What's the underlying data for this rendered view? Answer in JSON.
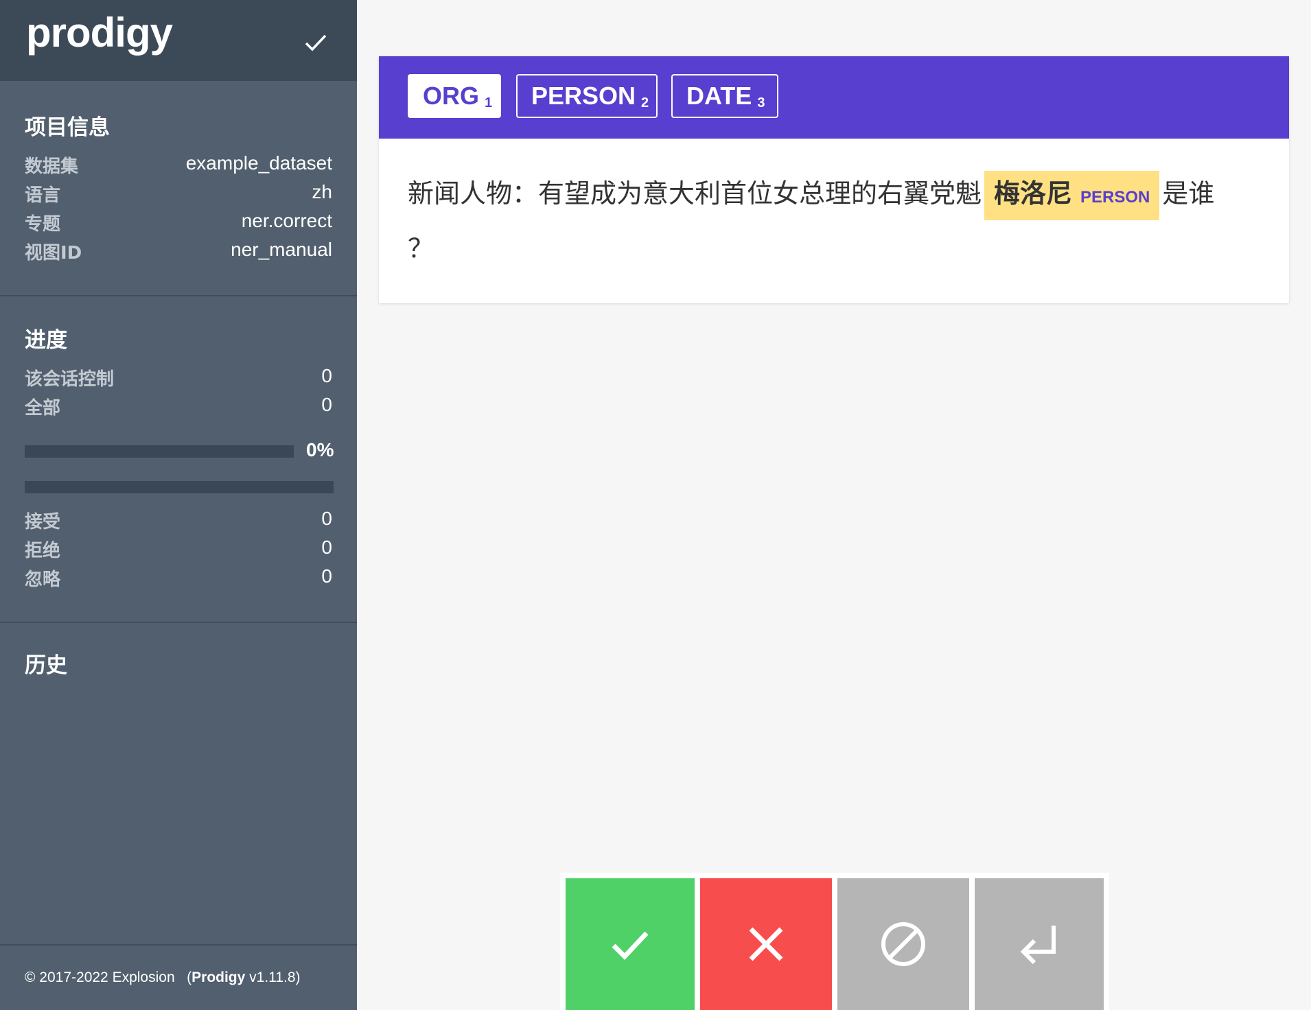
{
  "app": {
    "logo": "prodigy"
  },
  "sidebar": {
    "project_info": {
      "title": "项目信息",
      "rows": [
        {
          "label": "数据集",
          "value": "example_dataset"
        },
        {
          "label": "语言",
          "value": "zh"
        },
        {
          "label": "专题",
          "value": "ner.correct"
        },
        {
          "label": "视图ID",
          "value": "ner_manual"
        }
      ]
    },
    "progress": {
      "title": "进度",
      "rows": [
        {
          "label": "该会话控制",
          "value": "0"
        },
        {
          "label": "全部",
          "value": "0"
        }
      ],
      "percent_label": "0%",
      "percent_value": 0,
      "answers": [
        {
          "label": "接受",
          "value": "0"
        },
        {
          "label": "拒绝",
          "value": "0"
        },
        {
          "label": "忽略",
          "value": "0"
        }
      ]
    },
    "history": {
      "title": "历史"
    },
    "footer": {
      "copyright": "© 2017-2022 Explosion",
      "open": "(",
      "product": "Prodigy",
      "version": "v1.11.8",
      "close": ")"
    }
  },
  "labels": [
    {
      "name": "ORG",
      "key": "1",
      "active": true
    },
    {
      "name": "PERSON",
      "key": "2",
      "active": false
    },
    {
      "name": "DATE",
      "key": "3",
      "active": false
    }
  ],
  "task": {
    "before": "新闻人物：有望成为意大利首位女总理的右翼党魁",
    "entity_text": "梅洛尼",
    "entity_label": "PERSON",
    "after": "是谁",
    "line2": "？"
  },
  "colors": {
    "accent": "#583fcf",
    "accept": "#4fd168",
    "reject": "#f74d4d",
    "ignore": "#b5b5b5",
    "entity_highlight": "#ffe184"
  },
  "actions": [
    {
      "name": "accept",
      "icon": "check-icon"
    },
    {
      "name": "reject",
      "icon": "x-icon"
    },
    {
      "name": "ignore",
      "icon": "ban-icon"
    },
    {
      "name": "undo",
      "icon": "undo-arrow-icon"
    }
  ]
}
